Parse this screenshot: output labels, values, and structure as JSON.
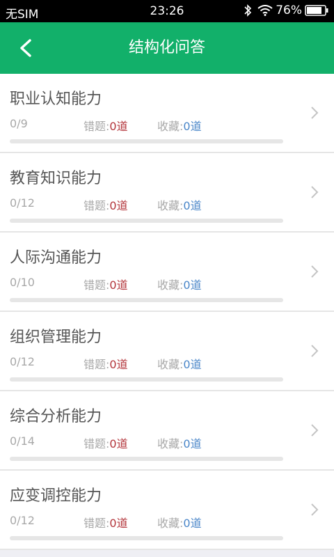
{
  "status": {
    "carrier": "无SIM",
    "time": "23:26",
    "battery": "76%"
  },
  "nav": {
    "title": "结构化问答",
    "back_icon": "chevron-left-icon"
  },
  "labels": {
    "wrong": "错题:",
    "favorite": "收藏:"
  },
  "colors": {
    "brand": "#12b06a",
    "wrong_count": "#b3343a",
    "favorite_count": "#4a86c8"
  },
  "items": [
    {
      "title": "职业认知能力",
      "progress": "0/9",
      "wrong": "0道",
      "favorite": "0道",
      "done_fraction": 0
    },
    {
      "title": "教育知识能力",
      "progress": "0/12",
      "wrong": "0道",
      "favorite": "0道",
      "done_fraction": 0
    },
    {
      "title": "人际沟通能力",
      "progress": "0/10",
      "wrong": "0道",
      "favorite": "0道",
      "done_fraction": 0
    },
    {
      "title": "组织管理能力",
      "progress": "0/12",
      "wrong": "0道",
      "favorite": "0道",
      "done_fraction": 0
    },
    {
      "title": "综合分析能力",
      "progress": "0/14",
      "wrong": "0道",
      "favorite": "0道",
      "done_fraction": 0
    },
    {
      "title": "应变调控能力",
      "progress": "0/12",
      "wrong": "0道",
      "favorite": "0道",
      "done_fraction": 0
    }
  ]
}
